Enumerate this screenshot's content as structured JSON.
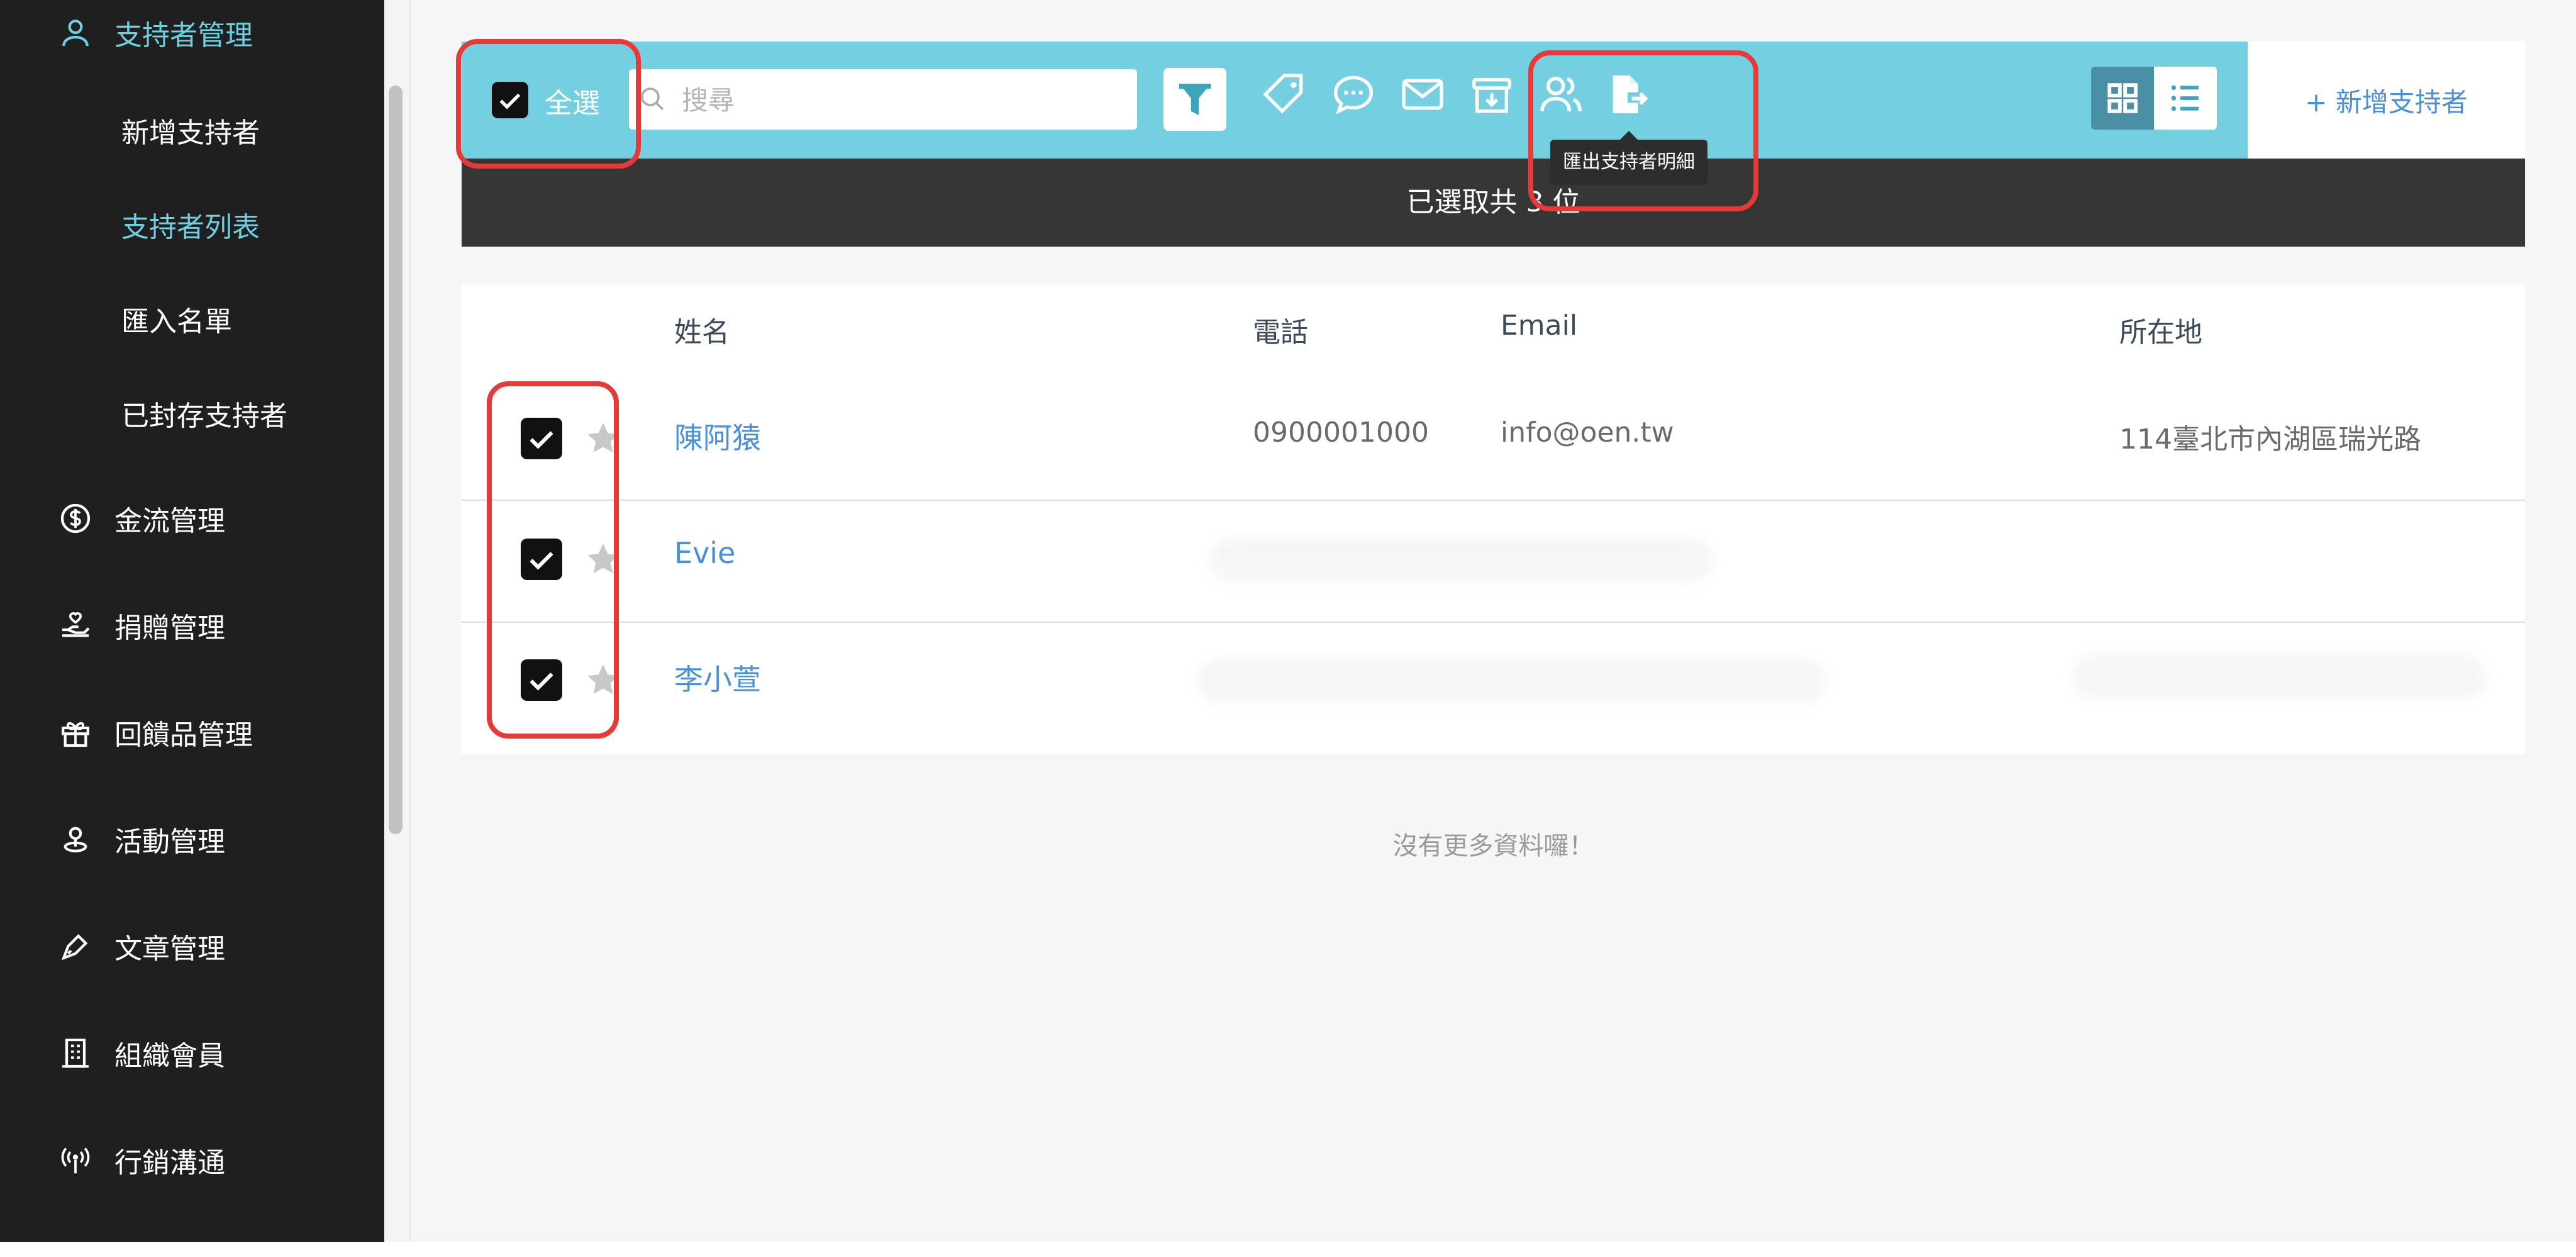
{
  "sidebar": {
    "sections": [
      {
        "label": "支持者管理",
        "icon": "user-icon",
        "active": true
      },
      {
        "label": "金流管理",
        "icon": "dollar-circle-icon"
      },
      {
        "label": "捐贈管理",
        "icon": "donation-hand-icon"
      },
      {
        "label": "回饋品管理",
        "icon": "gift-icon"
      },
      {
        "label": "活動管理",
        "icon": "location-pin-icon"
      },
      {
        "label": "文章管理",
        "icon": "pen-icon"
      },
      {
        "label": "組織會員",
        "icon": "building-icon"
      },
      {
        "label": "行銷溝通",
        "icon": "broadcast-icon"
      }
    ],
    "sub_items": [
      {
        "label": "新增支持者"
      },
      {
        "label": "支持者列表",
        "active": true
      },
      {
        "label": "匯入名單"
      },
      {
        "label": "已封存支持者"
      }
    ]
  },
  "toolbar": {
    "select_all_label": "全選",
    "search_placeholder": "搜尋",
    "icons": [
      "filter-icon",
      "tag-icon",
      "chat-icon",
      "mail-icon",
      "archive-icon",
      "users-icon",
      "export-file-icon"
    ],
    "tooltip": "匯出支持者明細",
    "add_label": "+ 新增支持者",
    "view_modes": [
      "grid-view-icon",
      "list-view-icon"
    ],
    "active_view": "grid"
  },
  "selection_bar": {
    "text": "已選取共 3 位"
  },
  "table": {
    "headers": {
      "name": "姓名",
      "phone": "電話",
      "email": "Email",
      "location": "所在地"
    },
    "rows": [
      {
        "name": "陳阿猿",
        "phone": "0900001000",
        "email": "info@oen.tw",
        "location": "114臺北市內湖區瑞光路",
        "checked": true
      },
      {
        "name": "Evie",
        "phone": "",
        "email": "",
        "location": "",
        "checked": true
      },
      {
        "name": "李小萱",
        "phone": "",
        "email": "",
        "location": "",
        "checked": true
      }
    ]
  },
  "footer": {
    "no_more": "沒有更多資料囉！"
  },
  "colors": {
    "accent": "#74d0e0",
    "sidebar_bg": "#1f1f1f",
    "link": "#4a90d9",
    "highlight": "#e63a3a"
  }
}
